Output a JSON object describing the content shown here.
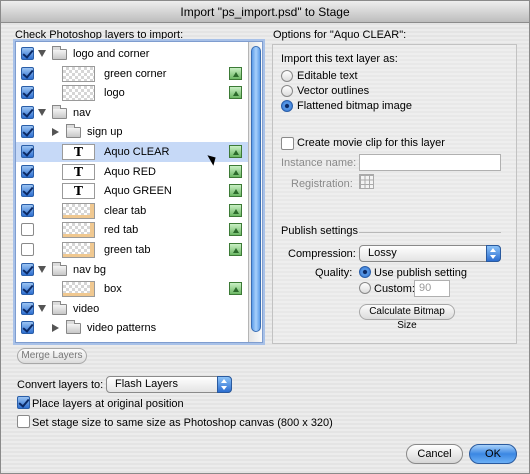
{
  "window": {
    "title": "Import \"ps_import.psd\" to Stage"
  },
  "left": {
    "heading": "Check Photoshop layers to import:",
    "layers": [
      {
        "name": "logo and corner",
        "checked": true,
        "kind": "folder",
        "indent": 0,
        "expanded": true,
        "pic": false,
        "selected": false
      },
      {
        "name": "green corner",
        "checked": true,
        "kind": "image",
        "indent": 1,
        "pic": true,
        "selected": false
      },
      {
        "name": "logo",
        "checked": true,
        "kind": "image",
        "indent": 1,
        "pic": true,
        "selected": false
      },
      {
        "name": "nav",
        "checked": true,
        "kind": "folder",
        "indent": 0,
        "expanded": true,
        "pic": false,
        "selected": false
      },
      {
        "name": "sign up",
        "checked": true,
        "kind": "folder",
        "indent": 1,
        "expanded": false,
        "pic": false,
        "selected": false
      },
      {
        "name": "Aquo CLEAR",
        "checked": true,
        "kind": "text",
        "indent": 1,
        "pic": true,
        "selected": true
      },
      {
        "name": "Aquo RED",
        "checked": true,
        "kind": "text",
        "indent": 1,
        "pic": true,
        "selected": false
      },
      {
        "name": "Aquo GREEN",
        "checked": true,
        "kind": "text",
        "indent": 1,
        "pic": true,
        "selected": false
      },
      {
        "name": "clear tab",
        "checked": true,
        "kind": "image-warm",
        "indent": 1,
        "pic": true,
        "selected": false
      },
      {
        "name": "red tab",
        "checked": false,
        "kind": "image-warm",
        "indent": 1,
        "pic": true,
        "selected": false
      },
      {
        "name": "green tab",
        "checked": false,
        "kind": "image-warm",
        "indent": 1,
        "pic": true,
        "selected": false
      },
      {
        "name": "nav bg",
        "checked": true,
        "kind": "folder",
        "indent": 0,
        "expanded": true,
        "pic": false,
        "selected": false
      },
      {
        "name": "box",
        "checked": true,
        "kind": "image-warm",
        "indent": 1,
        "pic": true,
        "selected": false
      },
      {
        "name": "video",
        "checked": true,
        "kind": "folder",
        "indent": 0,
        "expanded": true,
        "pic": false,
        "selected": false
      },
      {
        "name": "video patterns",
        "checked": true,
        "kind": "folder",
        "indent": 1,
        "expanded": false,
        "pic": false,
        "selected": false
      }
    ],
    "merge_button": "Merge Layers"
  },
  "options": {
    "heading": "Options for \"Aquo CLEAR\":",
    "import_as_label": "Import this text layer as:",
    "import_as": [
      "Editable text",
      "Vector outlines",
      "Flattened bitmap image"
    ],
    "import_as_selected": 2,
    "movie_clip_label": "Create movie clip for this layer",
    "instance_name_label": "Instance name:",
    "instance_name_value": "",
    "registration_label": "Registration:",
    "publish_heading": "Publish settings",
    "compression_label": "Compression:",
    "compression_value": "Lossy",
    "quality_label": "Quality:",
    "quality_options": [
      "Use publish setting",
      "Custom:"
    ],
    "quality_selected": 0,
    "custom_value": "90",
    "calc_button": "Calculate Bitmap Size"
  },
  "bottom": {
    "convert_label": "Convert layers to:",
    "convert_value": "Flash Layers",
    "place_label": "Place layers at original position",
    "place_checked": true,
    "stage_label": "Set stage size to same size as Photoshop canvas (800 x 320)",
    "stage_checked": false,
    "cancel": "Cancel",
    "ok": "OK"
  }
}
